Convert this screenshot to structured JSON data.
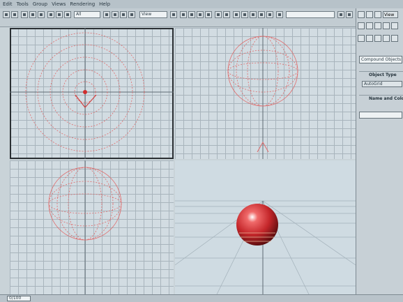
{
  "app": {
    "menus": [
      "Edit",
      "Tools",
      "Group",
      "Views",
      "Rendering",
      "Help"
    ]
  },
  "toolbar": {
    "selection_filter": "All",
    "reference_coord": "View",
    "named_selection": ""
  },
  "command_panel": {
    "tabs": [
      "create-icon",
      "modify-icon",
      "hierarchy-icon",
      "motion-icon",
      "display-icon",
      "utilities-icon"
    ],
    "category_dropdown": "Compound Objects",
    "object_type_section": "Object Type",
    "autogrid_label": "AutoGrid",
    "name_color_section": "Name and Color",
    "top_field_value": "View"
  },
  "status": {
    "field_value": "0/100"
  },
  "colors": {
    "wireframe": "#e06a6a",
    "sphere": "#c4262a"
  }
}
